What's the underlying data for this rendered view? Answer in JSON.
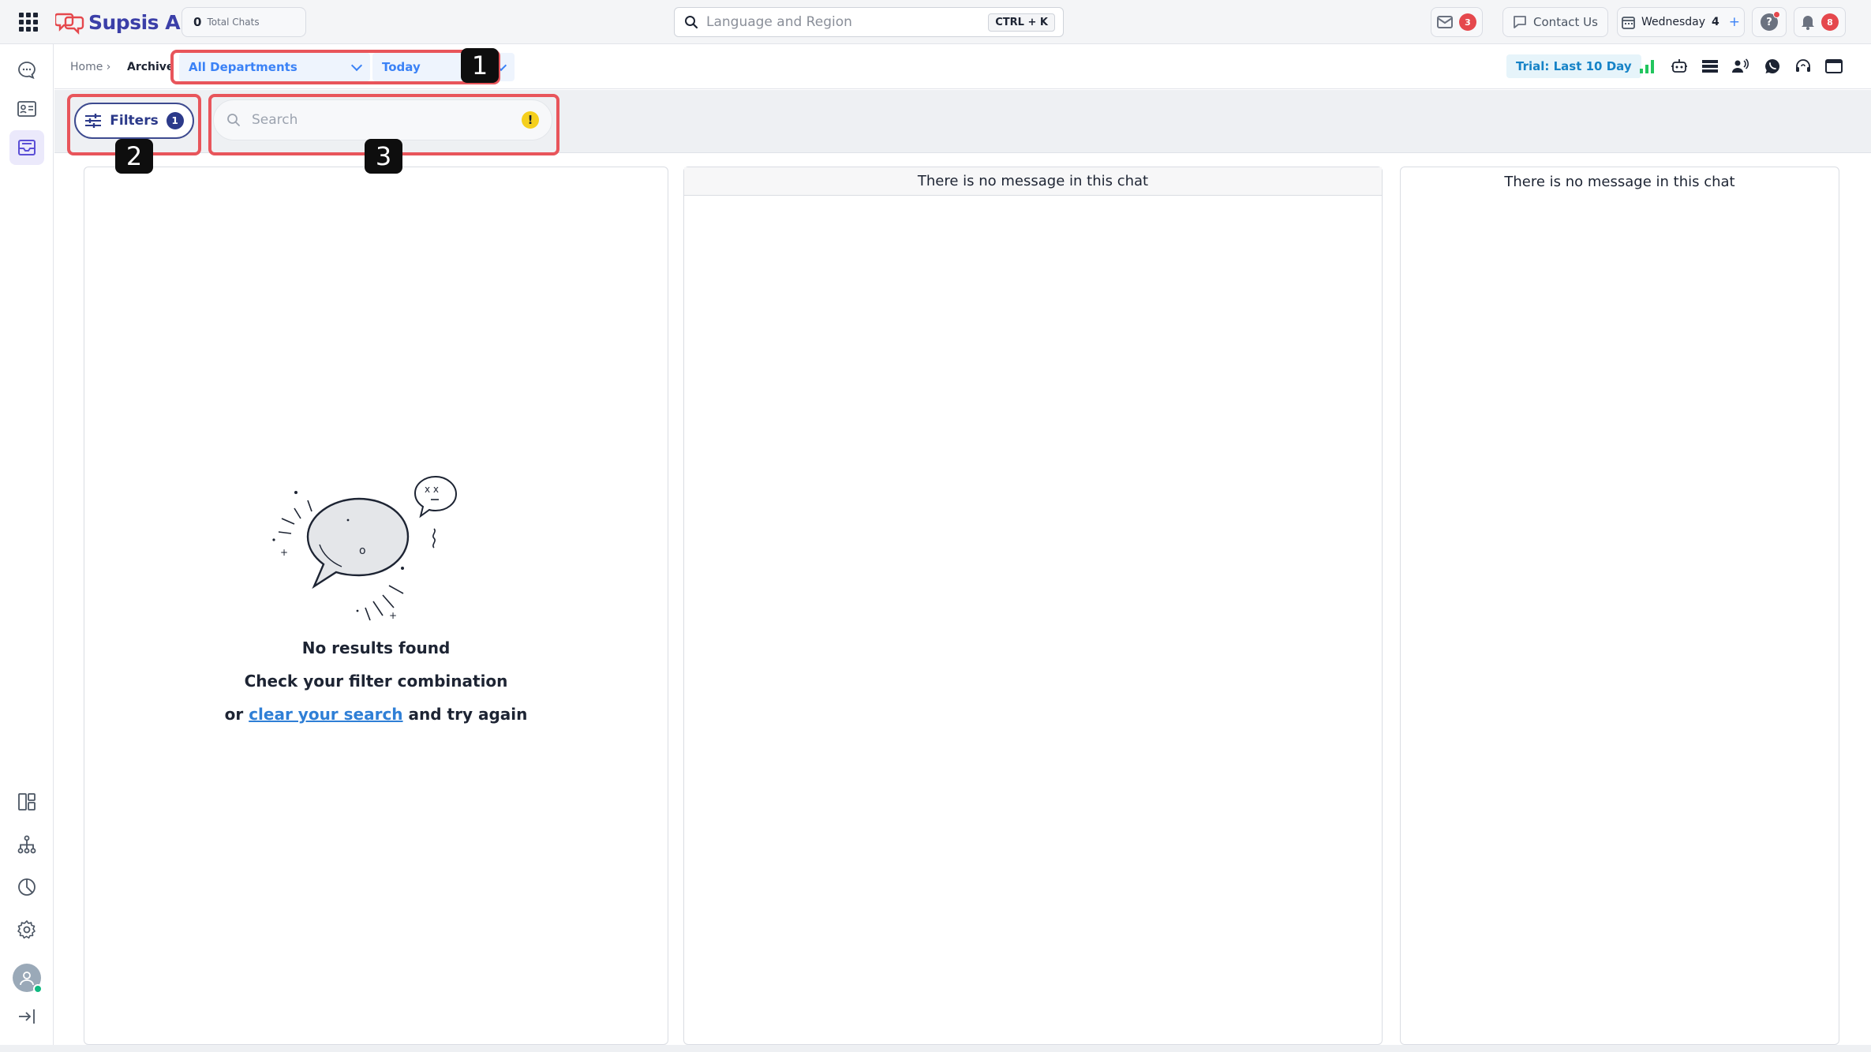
{
  "brand": {
    "name": "Supsis Ai",
    "colors": {
      "primary": "#3b3fa8",
      "accent_blue": "#3b82f6",
      "alert_red": "#e5484d",
      "annotation": "#e8555b"
    }
  },
  "topbar": {
    "total_chats_count": "0",
    "total_chats_label": "Total Chats",
    "search_placeholder": "Language and Region",
    "shortcut": "CTRL + K",
    "inbox_badge": "3",
    "contact_label": "Contact Us",
    "date_day": "Wednesday",
    "date_num": "4",
    "help_label": "?",
    "notifications_badge": "8"
  },
  "breadcrumb": {
    "home": "Home ›",
    "current": "Archive"
  },
  "subheader": {
    "department": "All Departments",
    "date_range": "Today",
    "trial": "Trial: Last 10 Day"
  },
  "filterbar": {
    "filters_label": "Filters",
    "filters_count": "1",
    "search_placeholder": "Search",
    "warning_glyph": "!"
  },
  "panels": {
    "left": {
      "title": "No results found",
      "subtitle": "Check your filter combination",
      "prefix": "or",
      "link": "clear your search",
      "suffix": "and try again"
    },
    "middle_message": "There is no message in this chat",
    "right_message": "There is no message in this chat"
  },
  "annotations": [
    "1",
    "2",
    "3"
  ],
  "icons": {
    "sidebar_top": [
      "chat-bubble-icon",
      "contact-card-icon",
      "inbox-archive-icon"
    ],
    "sidebar_bottom": [
      "layout-panels-icon",
      "org-tree-icon",
      "pie-chart-icon",
      "settings-gear-icon",
      "user-avatar",
      "logout-icon"
    ],
    "toolbar": [
      "signal-bars-icon",
      "bot-icon",
      "list-icon",
      "users-speaking-icon",
      "whatsapp-icon",
      "headset-icon",
      "window-icon"
    ]
  }
}
